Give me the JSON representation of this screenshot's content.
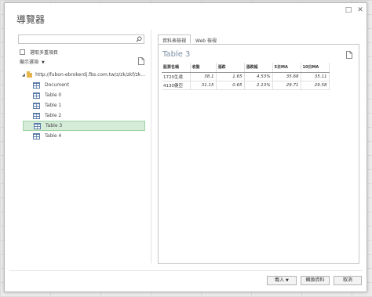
{
  "window": {
    "title": "導覽器",
    "restore_glyph": "□",
    "close_glyph": "✕"
  },
  "left": {
    "search_placeholder": "",
    "multi_select_label": "選取多重項目",
    "display_options_label": "顯示選項",
    "tree": {
      "root": "http://fubon-ebrokerdj.fbs.com.tw/z/zk/zkf/zk...",
      "items": [
        "Document",
        "Table 0",
        "Table 1",
        "Table 2",
        "Table 3",
        "Table 4"
      ],
      "selected": "Table 3"
    }
  },
  "right": {
    "tabs": [
      "資料表檢視",
      "Web 檢視"
    ],
    "active_tab": "資料表檢視",
    "preview_title": "Table 3",
    "table": {
      "headers": [
        "股票名稱",
        "收盤",
        "漲跌",
        "漲跌幅",
        "5日MA",
        "10日MA"
      ],
      "rows": [
        [
          "1720生達",
          "38.1",
          "1.65",
          "4.53%",
          "35.68",
          "35.11"
        ],
        [
          "4130健亞",
          "31.15",
          "0.65",
          "2.13%",
          "29.71",
          "29.58"
        ]
      ]
    }
  },
  "footer": {
    "load_label": "載入",
    "transform_label": "轉換資料",
    "cancel_label": "取消"
  },
  "colors": {
    "selection_bg": "#d5ecd9",
    "selection_border": "#9cd3a5",
    "preview_title": "#7a8ea4"
  }
}
